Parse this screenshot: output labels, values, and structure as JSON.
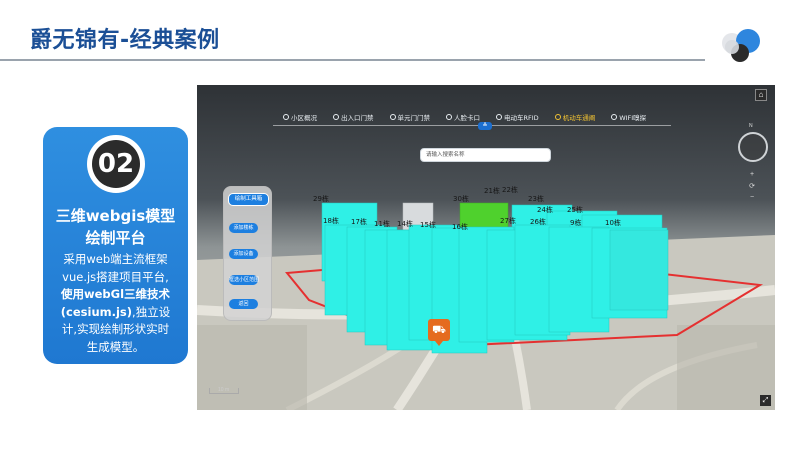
{
  "page": {
    "title": "爵无锦有-经典案例"
  },
  "card": {
    "number": "02",
    "heading_line1": "三维webgis模型",
    "heading_line2": "绘制平台",
    "desc_line1": "采用web端主流框架",
    "desc_line2": "vue.js搭建项目平台,",
    "desc_bold1": "使用webGl三维技术",
    "desc_bold2": "(cesium.js)",
    "desc_line3_tail": ",独立设",
    "desc_line4": "计,实现绘制形状实时",
    "desc_line5": "生成模型。"
  },
  "map": {
    "nav": [
      {
        "label": "小区概况",
        "icon": "building-icon"
      },
      {
        "label": "出入口门禁",
        "icon": "gate-icon"
      },
      {
        "label": "单元门门禁",
        "icon": "door-icon"
      },
      {
        "label": "人脸卡口",
        "icon": "face-icon"
      },
      {
        "label": "电动车RFID",
        "icon": "ebike-icon"
      },
      {
        "label": "机动车通阐",
        "icon": "car-icon",
        "active": true
      },
      {
        "label": "WIFI嗅探",
        "icon": "wifi-icon"
      }
    ],
    "nav_toggle": "≙",
    "search_placeholder": "请输入搜索名称",
    "tools": {
      "main": "绘制工具箱",
      "b1": "添加楼栋",
      "b2": "添加设备",
      "b3": "框选小区范围",
      "b4": "返回"
    },
    "buildings": [
      "29栋",
      "30栋",
      "21栋",
      "22栋",
      "23栋",
      "24栋",
      "25栋",
      "18栋",
      "17栋",
      "11栋",
      "14栋",
      "15栋",
      "16栋",
      "27栋",
      "26栋",
      "9栋",
      "10栋"
    ],
    "compass_label": "N",
    "zoom_in": "+",
    "zoom_reset": "⟳",
    "zoom_out": "−",
    "scale_label": "10 m",
    "colors": {
      "building": "#2ff0e6",
      "highlight": "#4fd12d",
      "boundary": "#e53030",
      "accent": "#1d7fe0",
      "card": "#2a86dc"
    }
  }
}
